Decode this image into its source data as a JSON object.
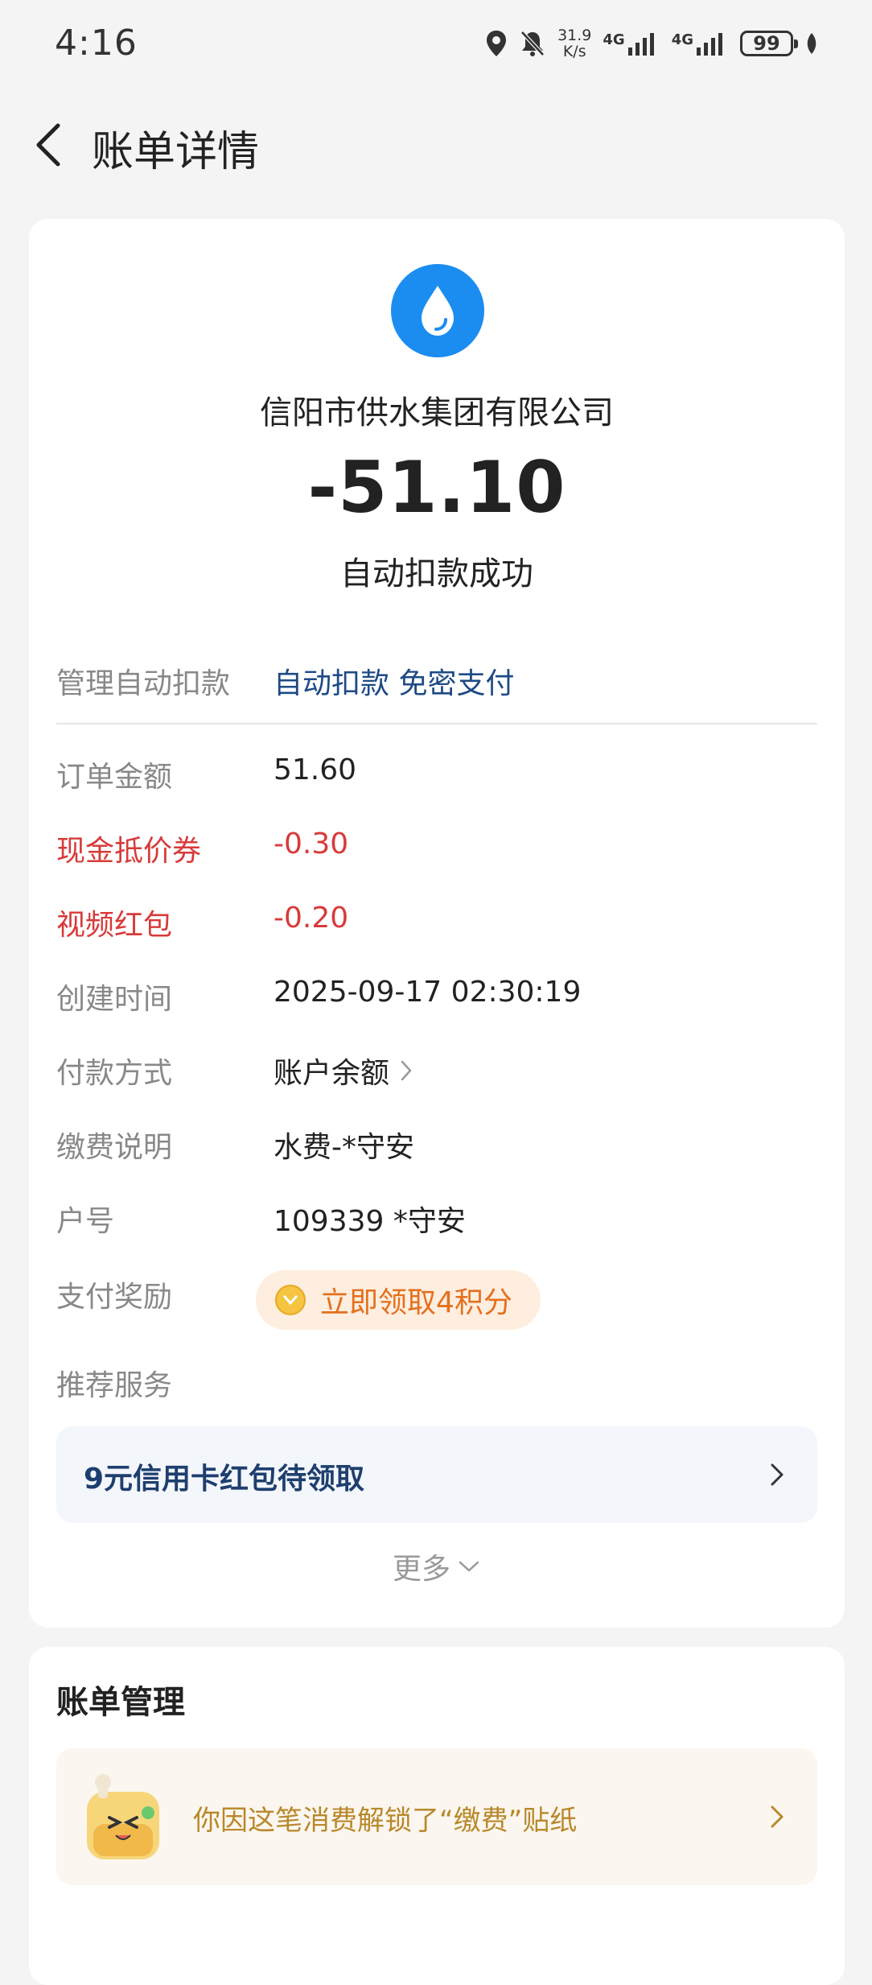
{
  "status_bar": {
    "time": "4:16",
    "net_speed_value": "31.9",
    "net_speed_unit": "K/s",
    "network_1": "4G",
    "network_2": "4G",
    "battery": "99"
  },
  "nav": {
    "title": "账单详情"
  },
  "bill": {
    "merchant_name": "信阳市供水集团有限公司",
    "amount": "-51.10",
    "status": "自动扣款成功",
    "logo_color": "#1b8df0"
  },
  "auto_deduct": {
    "label": "管理自动扣款",
    "value": "自动扣款 免密支付"
  },
  "details": [
    {
      "label": "订单金额",
      "value": "51.60"
    },
    {
      "label": "现金抵价券",
      "value": "-0.30"
    },
    {
      "label": "视频红包",
      "value": "-0.20"
    },
    {
      "label": "创建时间",
      "value": "2025-09-17 02:30:19"
    },
    {
      "label": "付款方式",
      "value": "账户余额"
    },
    {
      "label": "缴费说明",
      "value": "水费-*守安"
    },
    {
      "label": "户号",
      "value": "109339 *守安"
    }
  ],
  "reward": {
    "label": "支付奖励",
    "button": "立即领取4积分"
  },
  "recommend": {
    "label": "推荐服务",
    "promo": "9元信用卡红包待领取"
  },
  "more": "更多",
  "bill_management": {
    "title": "账单管理",
    "sticker_text": "你因这笔消费解锁了“缴费”贴纸"
  },
  "colors": {
    "accent_blue": "#1e4a86",
    "discount_red": "#d83a3a",
    "reward_orange": "#e4701d"
  }
}
